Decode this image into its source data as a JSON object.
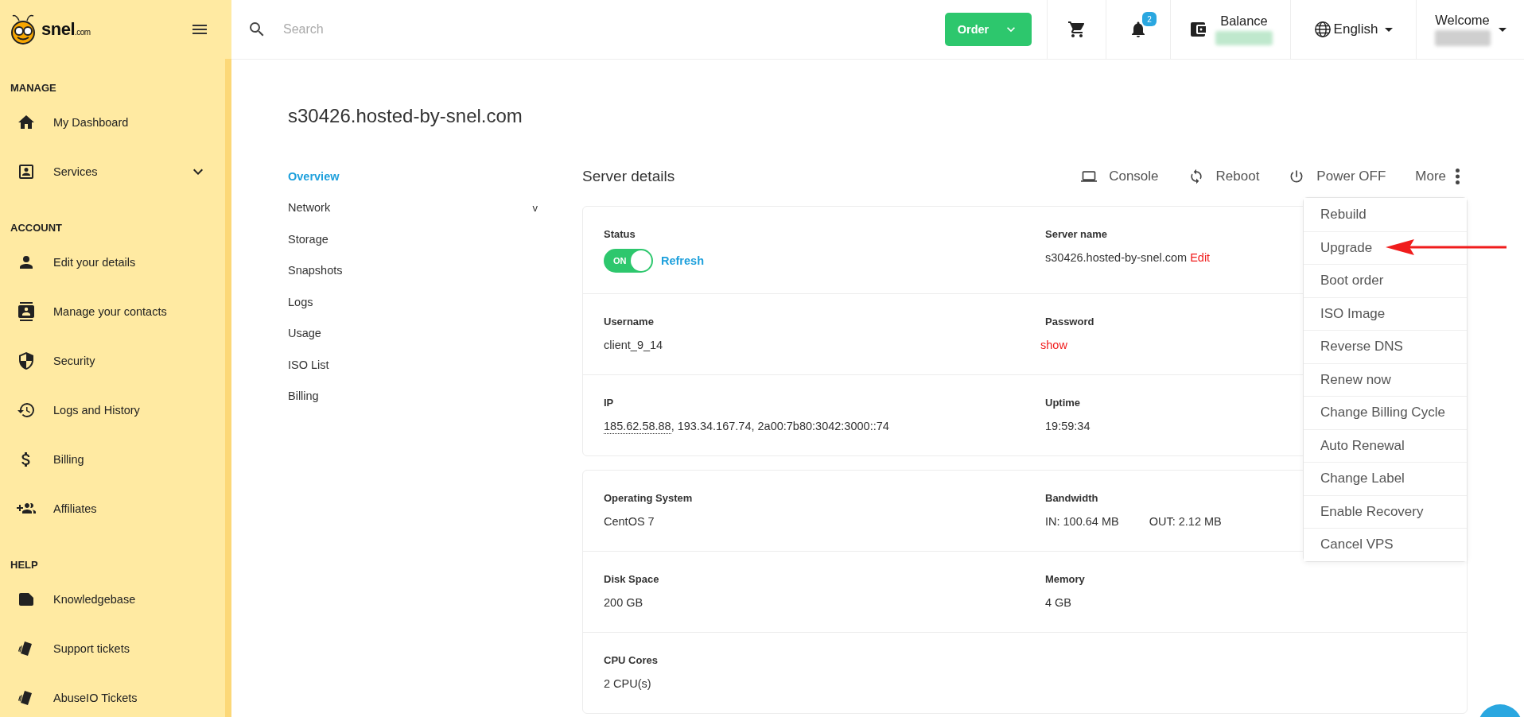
{
  "brand": {
    "name": "snel",
    "suffix": ".com"
  },
  "sidebar": {
    "sections": [
      {
        "heading": "MANAGE",
        "items": [
          {
            "label": "My Dashboard",
            "has_submenu": false
          },
          {
            "label": "Services",
            "has_submenu": true
          }
        ]
      },
      {
        "heading": "ACCOUNT",
        "items": [
          {
            "label": "Edit your details",
            "has_submenu": false
          },
          {
            "label": "Manage your contacts",
            "has_submenu": false
          },
          {
            "label": "Security",
            "has_submenu": false
          },
          {
            "label": "Logs and History",
            "has_submenu": false
          },
          {
            "label": "Billing",
            "has_submenu": false
          },
          {
            "label": "Affiliates",
            "has_submenu": false
          }
        ]
      },
      {
        "heading": "HELP",
        "items": [
          {
            "label": "Knowledgebase",
            "has_submenu": false
          },
          {
            "label": "Support tickets",
            "has_submenu": false
          },
          {
            "label": "AbuseIO Tickets",
            "has_submenu": false
          }
        ]
      }
    ]
  },
  "topbar": {
    "search": {
      "placeholder": "Search"
    },
    "order_button": "Order",
    "notifications": {
      "badge": "2"
    },
    "balance": {
      "label": "Balance"
    },
    "language": "English",
    "welcome": {
      "label": "Welcome"
    }
  },
  "page": {
    "title": "s30426.hosted-by-snel.com"
  },
  "subnav": [
    {
      "label": "Overview",
      "selected": true
    },
    {
      "label": "Network",
      "selected": false,
      "toggle": "v"
    },
    {
      "label": "Storage",
      "selected": false
    },
    {
      "label": "Snapshots",
      "selected": false
    },
    {
      "label": "Logs",
      "selected": false
    },
    {
      "label": "Usage",
      "selected": false
    },
    {
      "label": "ISO List",
      "selected": false
    },
    {
      "label": "Billing",
      "selected": false
    }
  ],
  "details": {
    "title": "Server details",
    "actions": [
      {
        "label": "Console",
        "kind": "console"
      },
      {
        "label": "Reboot",
        "kind": "reboot"
      },
      {
        "label": "Power OFF",
        "kind": "power"
      },
      {
        "label": "More",
        "kind": "more"
      }
    ],
    "cards": [
      {
        "rows": [
          [
            {
              "label": "Status",
              "toggle": {
                "on": true,
                "text": "ON"
              },
              "values": [
                {
                  "text": "Refresh",
                  "kind": "link"
                }
              ]
            },
            {
              "label": "Server name",
              "values": [
                {
                  "text": "s30426.hosted-by-snel.com",
                  "kind": "plain"
                },
                {
                  "text": "Edit",
                  "kind": "danger"
                }
              ]
            }
          ],
          [
            {
              "label": "Username",
              "values": [
                {
                  "text": "client_9_14",
                  "kind": "plain"
                }
              ]
            },
            {
              "label": "Password",
              "values": [
                {
                  "text": "show",
                  "kind": "danger"
                }
              ]
            }
          ],
          [
            {
              "label": "IP",
              "values": [
                {
                  "text": "185.62.58.88",
                  "kind": "dotted"
                },
                {
                  "text": ", 193.34.167.74, 2a00:7b80:3042:3000::74",
                  "kind": "plain"
                }
              ]
            },
            {
              "label": "Uptime",
              "values": [
                {
                  "text": "19:59:34",
                  "kind": "plain"
                }
              ]
            }
          ]
        ]
      },
      {
        "rows": [
          [
            {
              "label": "Operating System",
              "values": [
                {
                  "text": "CentOS 7",
                  "kind": "plain"
                }
              ]
            },
            {
              "label": "Bandwidth",
              "values": [
                {
                  "text": "IN: 100.64 MB",
                  "kind": "plain"
                },
                {
                  "text": "OUT: 2.12 MB",
                  "kind": "spaced"
                }
              ]
            }
          ],
          [
            {
              "label": "Disk Space",
              "values": [
                {
                  "text": "200 GB",
                  "kind": "plain"
                }
              ]
            },
            {
              "label": "Memory",
              "values": [
                {
                  "text": "4 GB",
                  "kind": "plain"
                }
              ]
            }
          ],
          [
            {
              "label": "CPU Cores",
              "values": [
                {
                  "text": "2 CPU(s)",
                  "kind": "plain"
                }
              ]
            }
          ]
        ]
      }
    ],
    "more_menu": [
      {
        "label": "Rebuild",
        "annotated": false
      },
      {
        "label": "Upgrade",
        "annotated": true
      },
      {
        "label": "Boot order",
        "annotated": false
      },
      {
        "label": "ISO Image",
        "annotated": false
      },
      {
        "label": "Reverse DNS",
        "annotated": false
      },
      {
        "label": "Renew now",
        "annotated": false
      },
      {
        "label": "Change Billing Cycle",
        "annotated": false
      },
      {
        "label": "Auto Renewal",
        "annotated": false
      },
      {
        "label": "Change Label",
        "annotated": false
      },
      {
        "label": "Enable Recovery",
        "annotated": false
      },
      {
        "label": "Cancel VPS",
        "annotated": false
      }
    ]
  }
}
